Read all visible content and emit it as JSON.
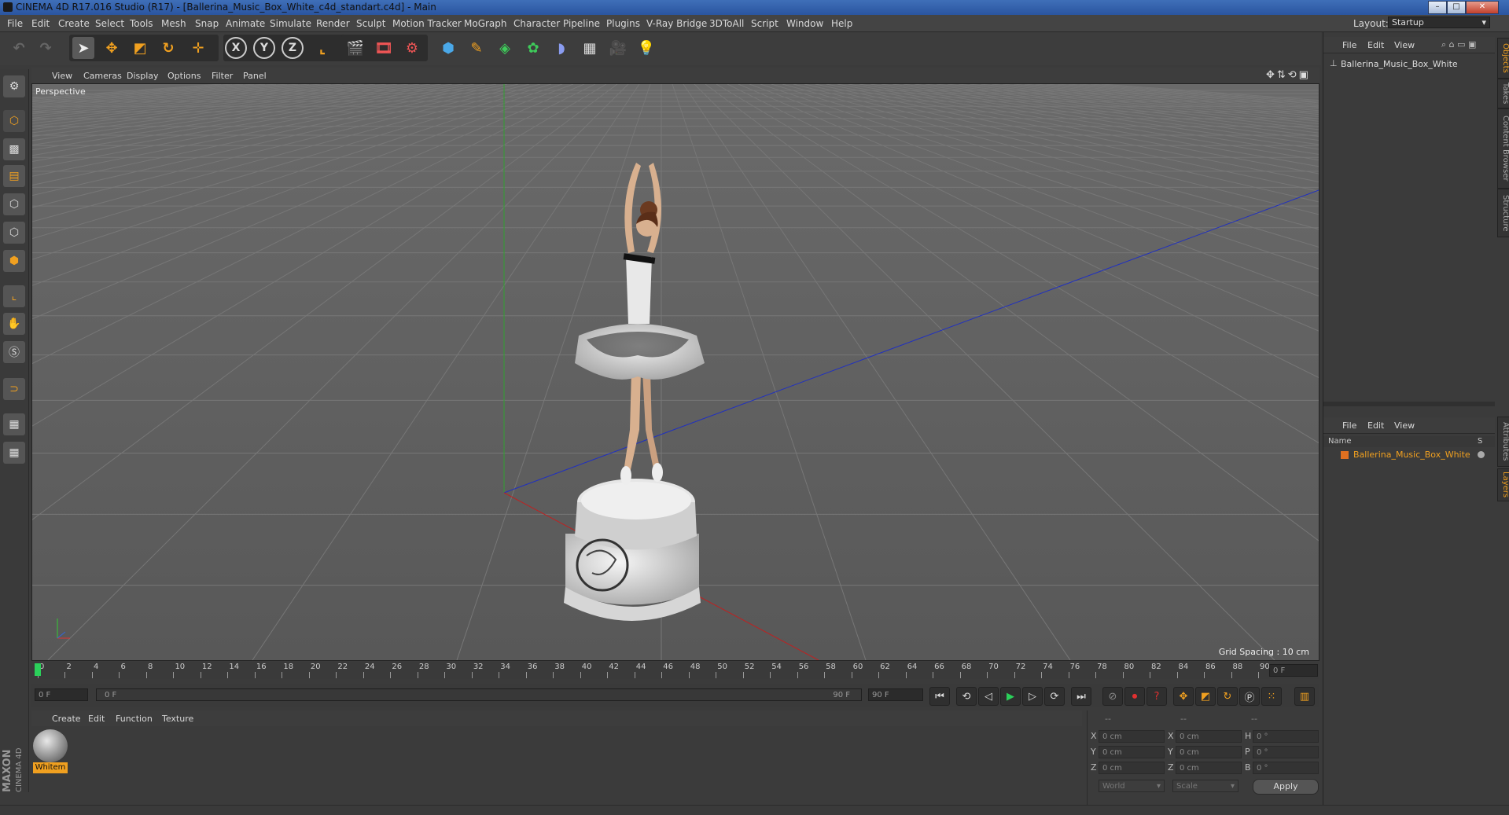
{
  "titlebar": {
    "title": "CINEMA 4D R17.016 Studio (R17) - [Ballerina_Music_Box_White_c4d_standart.c4d] - Main",
    "minimize": "–",
    "maximize": "□",
    "close": "✕"
  },
  "menubar": {
    "items": [
      "File",
      "Edit",
      "Create",
      "Select",
      "Tools",
      "Mesh",
      "Snap",
      "Animate",
      "Simulate",
      "Render",
      "Sculpt",
      "Motion Tracker",
      "MoGraph",
      "Character",
      "Pipeline",
      "Plugins",
      "V-Ray Bridge",
      "3DToAll",
      "Script",
      "Window",
      "Help"
    ],
    "layout_label": "Layout:",
    "layout_value": "Startup"
  },
  "toolbar": {
    "axis_x": "X",
    "axis_y": "Y",
    "axis_z": "Z"
  },
  "viewport": {
    "menu": [
      "View",
      "Cameras",
      "Display",
      "Options",
      "Filter",
      "Panel"
    ],
    "camera_label": "Perspective",
    "grid_spacing": "Grid Spacing : 10 cm"
  },
  "timeline": {
    "ticks": [
      "0",
      "2",
      "4",
      "6",
      "8",
      "10",
      "12",
      "14",
      "16",
      "18",
      "20",
      "22",
      "24",
      "26",
      "28",
      "30",
      "32",
      "34",
      "36",
      "38",
      "40",
      "42",
      "44",
      "46",
      "48",
      "50",
      "52",
      "54",
      "56",
      "58",
      "60",
      "62",
      "64",
      "66",
      "68",
      "70",
      "72",
      "74",
      "76",
      "78",
      "80",
      "82",
      "84",
      "86",
      "88",
      "90"
    ],
    "current_frame": "0 F",
    "start_frame": "0 F",
    "range_start": "0 F",
    "range_end": "90 F",
    "end_frame": "90 F",
    "playhead_fraction": 0
  },
  "material_manager": {
    "menu": [
      "Create",
      "Edit",
      "Function",
      "Texture"
    ],
    "material_name": "Whitem"
  },
  "coordinates": {
    "headers": [
      "--",
      "--",
      "--"
    ],
    "rows": [
      {
        "a": "X",
        "av": "0 cm",
        "b": "X",
        "bv": "0 cm",
        "c": "H",
        "cv": "0 °"
      },
      {
        "a": "Y",
        "av": "0 cm",
        "b": "Y",
        "bv": "0 cm",
        "c": "P",
        "cv": "0 °"
      },
      {
        "a": "Z",
        "av": "0 cm",
        "b": "Z",
        "bv": "0 cm",
        "c": "B",
        "cv": "0 °"
      }
    ],
    "mode_world": "World",
    "mode_scale": "Scale",
    "apply_label": "Apply"
  },
  "object_manager": {
    "menu": [
      "File",
      "Edit",
      "View"
    ],
    "object_name": "Ballerina_Music_Box_White"
  },
  "layer_manager": {
    "menu": [
      "File",
      "Edit",
      "View"
    ],
    "col_name": "Name",
    "col_s": "S",
    "layer_name": "Ballerina_Music_Box_White",
    "layer_color": "#e07020"
  },
  "side_tabs": [
    "Objects",
    "Takes",
    "Content Browser",
    "Structure",
    "Attributes",
    "Layers"
  ],
  "branding": {
    "maxon": "MAXON",
    "cinema": "CINEMA 4D"
  },
  "colors": {
    "accent": "#f0a020",
    "selected_text": "#f0a020",
    "x_axis": "#c02020",
    "z_axis": "#2030c0",
    "y_axis": "#30a030"
  }
}
